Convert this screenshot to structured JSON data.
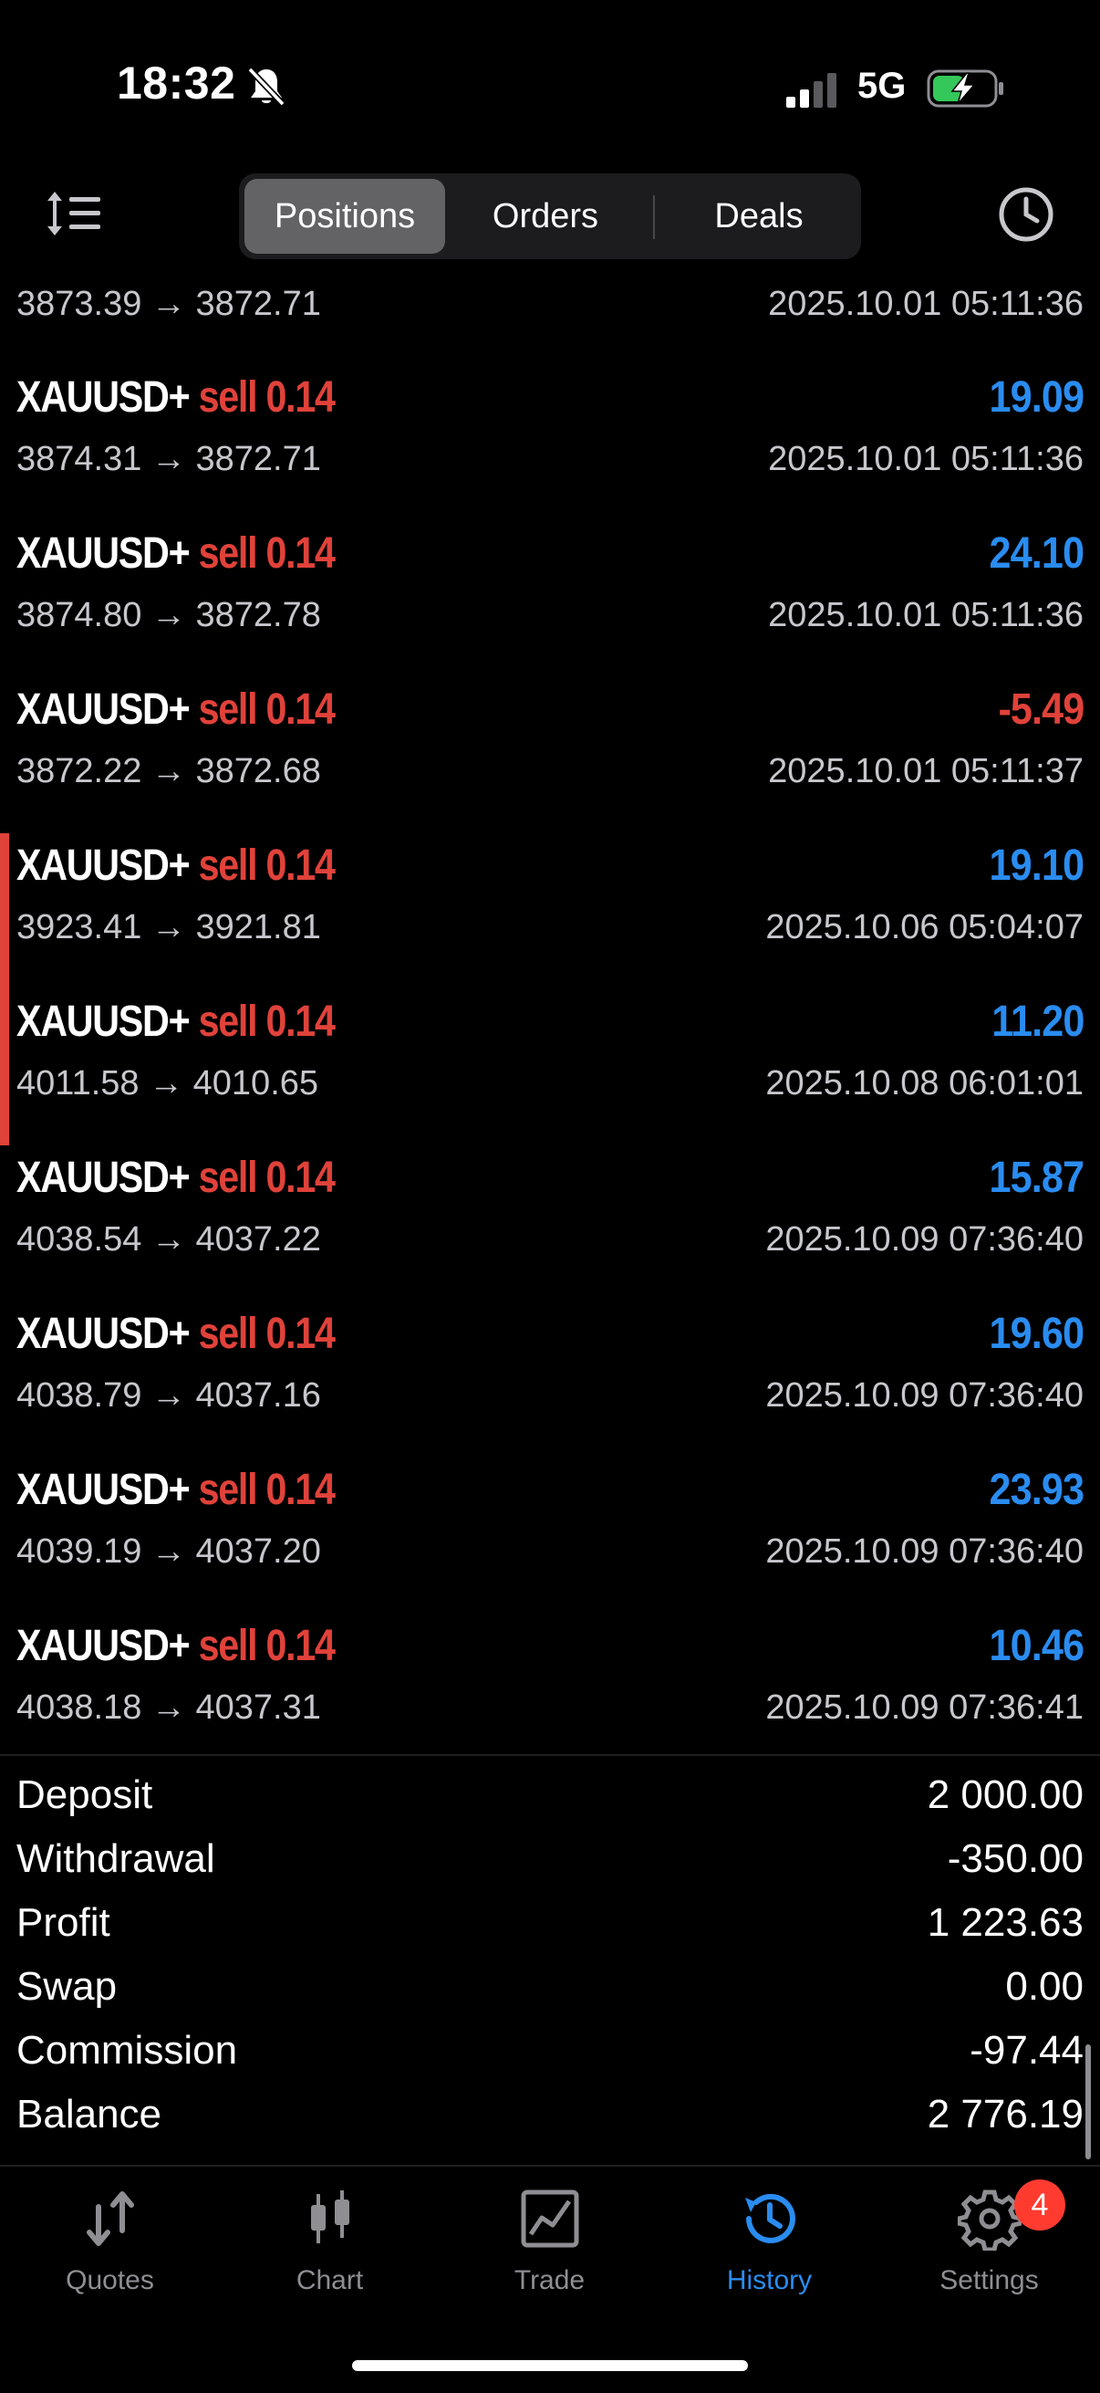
{
  "status_bar": {
    "time": "18:32",
    "network": "5G"
  },
  "toolbar": {
    "tabs": [
      {
        "label": "Positions",
        "active": true
      },
      {
        "label": "Orders",
        "active": false
      },
      {
        "label": "Deals",
        "active": false
      }
    ]
  },
  "positions": {
    "partial": {
      "prices": "3873.39 → 3872.71",
      "time": "2025.10.01 05:11:36"
    },
    "rows": [
      {
        "symbol": "XAUUSD+",
        "side": "sell",
        "volume": "0.14",
        "profit": "19.09",
        "profit_sign": "pos",
        "prices": "3874.31 → 3872.71",
        "time": "2025.10.01 05:11:36",
        "highlight": false
      },
      {
        "symbol": "XAUUSD+",
        "side": "sell",
        "volume": "0.14",
        "profit": "24.10",
        "profit_sign": "pos",
        "prices": "3874.80 → 3872.78",
        "time": "2025.10.01 05:11:36",
        "highlight": false
      },
      {
        "symbol": "XAUUSD+",
        "side": "sell",
        "volume": "0.14",
        "profit": "-5.49",
        "profit_sign": "neg",
        "prices": "3872.22 → 3872.68",
        "time": "2025.10.01 05:11:37",
        "highlight": false
      },
      {
        "symbol": "XAUUSD+",
        "side": "sell",
        "volume": "0.14",
        "profit": "19.10",
        "profit_sign": "pos",
        "prices": "3923.41 → 3921.81",
        "time": "2025.10.06 05:04:07",
        "highlight": true
      },
      {
        "symbol": "XAUUSD+",
        "side": "sell",
        "volume": "0.14",
        "profit": "11.20",
        "profit_sign": "pos",
        "prices": "4011.58 → 4010.65",
        "time": "2025.10.08 06:01:01",
        "highlight": true
      },
      {
        "symbol": "XAUUSD+",
        "side": "sell",
        "volume": "0.14",
        "profit": "15.87",
        "profit_sign": "pos",
        "prices": "4038.54 → 4037.22",
        "time": "2025.10.09 07:36:40",
        "highlight": false
      },
      {
        "symbol": "XAUUSD+",
        "side": "sell",
        "volume": "0.14",
        "profit": "19.60",
        "profit_sign": "pos",
        "prices": "4038.79 → 4037.16",
        "time": "2025.10.09 07:36:40",
        "highlight": false
      },
      {
        "symbol": "XAUUSD+",
        "side": "sell",
        "volume": "0.14",
        "profit": "23.93",
        "profit_sign": "pos",
        "prices": "4039.19 → 4037.20",
        "time": "2025.10.09 07:36:40",
        "highlight": false
      },
      {
        "symbol": "XAUUSD+",
        "side": "sell",
        "volume": "0.14",
        "profit": "10.46",
        "profit_sign": "pos",
        "prices": "4038.18 → 4037.31",
        "time": "2025.10.09 07:36:41",
        "highlight": false
      }
    ]
  },
  "summary": [
    {
      "label": "Deposit",
      "value": "2 000.00"
    },
    {
      "label": "Withdrawal",
      "value": "-350.00"
    },
    {
      "label": "Profit",
      "value": "1 223.63"
    },
    {
      "label": "Swap",
      "value": "0.00"
    },
    {
      "label": "Commission",
      "value": "-97.44"
    },
    {
      "label": "Balance",
      "value": "2 776.19"
    }
  ],
  "tab_bar": {
    "tabs": [
      {
        "label": "Quotes",
        "icon": "quotes-arrows-icon",
        "active": false
      },
      {
        "label": "Chart",
        "icon": "candlestick-icon",
        "active": false
      },
      {
        "label": "Trade",
        "icon": "trade-chart-icon",
        "active": false
      },
      {
        "label": "History",
        "icon": "history-icon",
        "active": true
      },
      {
        "label": "Settings",
        "icon": "gear-icon",
        "active": false,
        "badge": "4"
      }
    ]
  },
  "colors": {
    "background": "#000000",
    "profit_positive": "#2a8cf0",
    "sell": "#e0423a",
    "active_tab": "#2a8cf0",
    "inactive_tab": "#8e8e93",
    "badge": "#ff3b30"
  }
}
